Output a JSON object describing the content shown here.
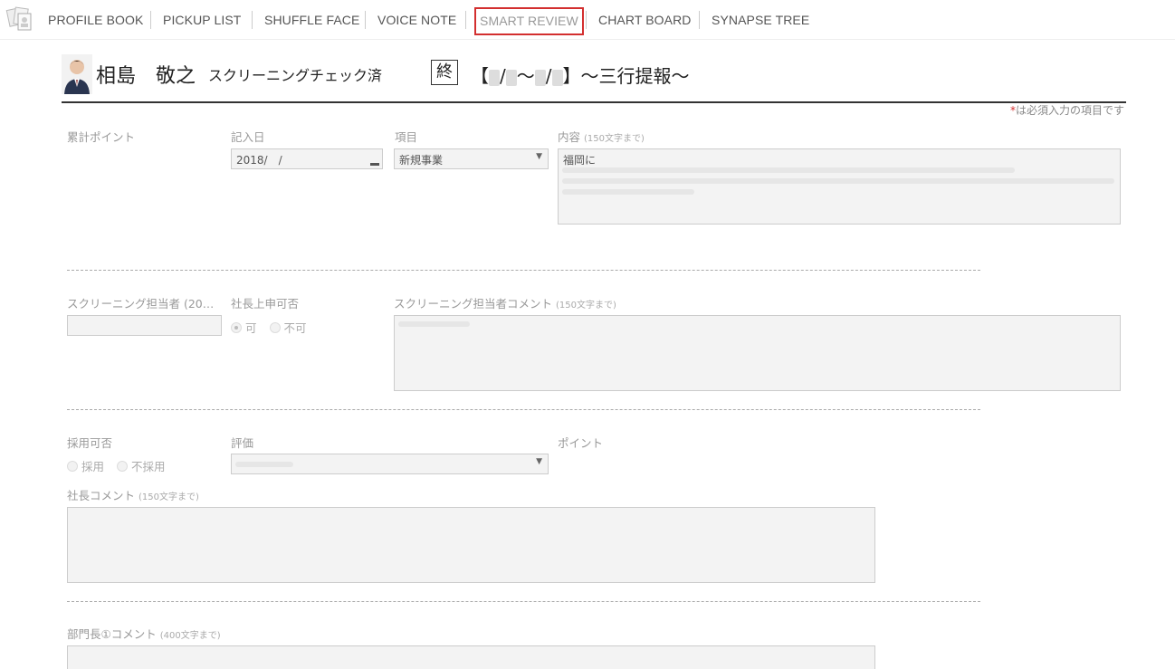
{
  "nav": {
    "items": [
      {
        "label": "PROFILE BOOK"
      },
      {
        "label": "PICKUP LIST"
      },
      {
        "label": "SHUFFLE FACE"
      },
      {
        "label": "VOICE NOTE"
      },
      {
        "label": "SMART REVIEW",
        "active": true
      },
      {
        "label": "CHART BOARD"
      },
      {
        "label": "SYNAPSE TREE"
      }
    ]
  },
  "header": {
    "name": "相島　敬之",
    "status": "スクリーニングチェック済",
    "end_mark": "終",
    "period_open": "【",
    "period_sep1": "/",
    "period_tilde": "～",
    "period_sep2": "/",
    "period_close": "】～三行提報～"
  },
  "required_note_star": "*",
  "required_note_text": "は必須入力の項目です",
  "section1": {
    "cumulative_points_label": "累計ポイント",
    "entry_date_label": "記入日",
    "entry_date_value": "2018/　/",
    "item_label": "項目",
    "item_value": "新規事業",
    "content_label": "内容",
    "content_note": "(150文字まで)",
    "content_value": "福岡に"
  },
  "section2": {
    "screener_label": "スクリーニング担当者 (20…",
    "president_report_label": "社長上申可否",
    "radio_yes": "可",
    "radio_no": "不可",
    "screener_comment_label": "スクリーニング担当者コメント",
    "screener_comment_note": "(150文字まで)"
  },
  "section3": {
    "hire_label": "採用可否",
    "hire_yes": "採用",
    "hire_no": "不採用",
    "evaluation_label": "評価",
    "points_label": "ポイント",
    "president_comment_label": "社長コメント",
    "president_comment_note": "(150文字まで)"
  },
  "section4": {
    "dept_head_comment_label": "部門長①コメント",
    "dept_head_comment_note": "(400文字まで)"
  },
  "colors": {
    "accent_red": "#d32f2f",
    "field_bg": "#f3f3f3"
  }
}
